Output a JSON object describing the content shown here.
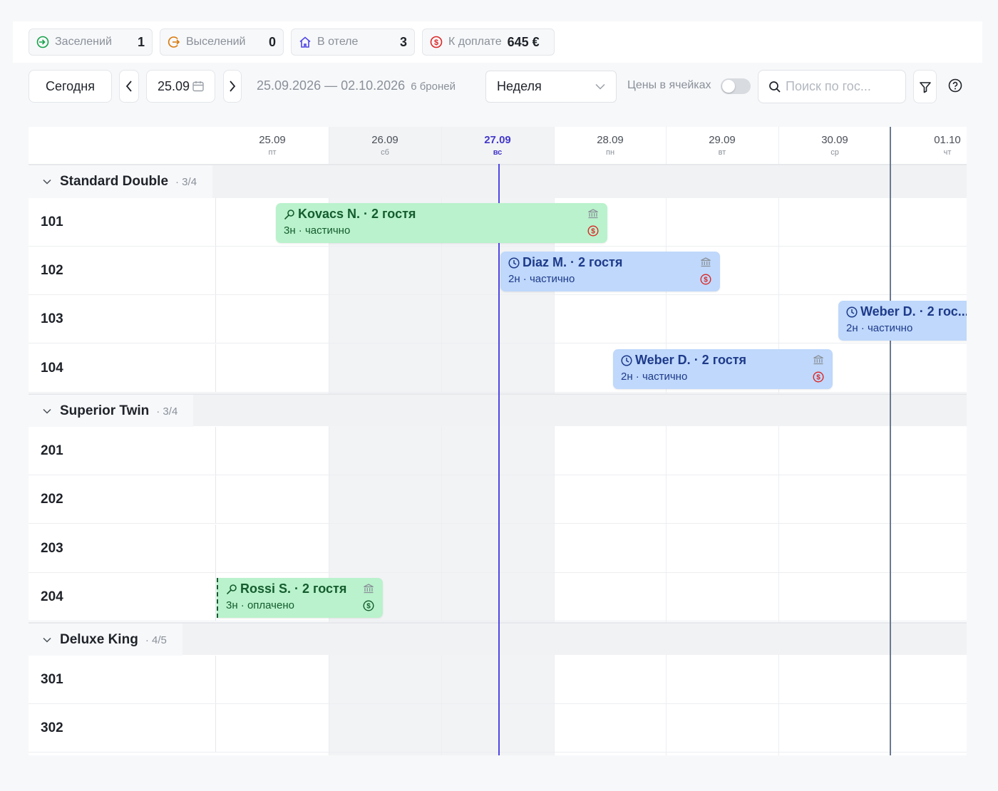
{
  "stats": {
    "checkins": {
      "label": "Заселений",
      "value": "1"
    },
    "checkouts": {
      "label": "Выселений",
      "value": "0"
    },
    "in_hotel": {
      "label": "В отеле",
      "value": "3"
    },
    "due": {
      "label": "К доплате",
      "value": "645 €"
    }
  },
  "toolbar": {
    "today_label": "Сегодня",
    "date_value": "25.09",
    "range": "25.09.2026 — 02.10.2026",
    "bookings_count": "6 броней",
    "view_select": "Неделя",
    "prices_label": "Цены в ячейках",
    "search_placeholder": "Поиск по гос..."
  },
  "days": [
    {
      "date": "25.09",
      "weekday": "пт"
    },
    {
      "date": "26.09",
      "weekday": "сб"
    },
    {
      "date": "27.09",
      "weekday": "вс"
    },
    {
      "date": "28.09",
      "weekday": "пн"
    },
    {
      "date": "29.09",
      "weekday": "вт"
    },
    {
      "date": "30.09",
      "weekday": "ср"
    },
    {
      "date": "01.10",
      "weekday": "чт"
    }
  ],
  "groups": [
    {
      "name": "Standard Double",
      "count": "· 3/4",
      "rooms": [
        "101",
        "102",
        "103",
        "104"
      ]
    },
    {
      "name": "Superior Twin",
      "count": "· 3/4",
      "rooms": [
        "201",
        "202",
        "203",
        "204"
      ]
    },
    {
      "name": "Deluxe King",
      "count": "· 4/5",
      "rooms": [
        "301",
        "302"
      ]
    }
  ],
  "bookings": [
    {
      "title": "Kovacs N. · 2 гостя",
      "sub": "3н · частично",
      "color": "green",
      "icon": "key-icon",
      "pay_status": "partial"
    },
    {
      "title": "Diaz M. · 2 гостя",
      "sub": "2н · частично",
      "color": "blue",
      "icon": "clock-icon",
      "pay_status": "partial"
    },
    {
      "title": "Weber D. · 2 гос...",
      "sub": "2н · частично",
      "color": "blue",
      "icon": "clock-icon",
      "pay_status": "partial"
    },
    {
      "title": "Weber D. · 2 гостя",
      "sub": "2н · частично",
      "color": "blue",
      "icon": "clock-icon",
      "pay_status": "partial"
    },
    {
      "title": "Rossi S. · 2 гостя",
      "sub": "3н · оплачено",
      "color": "green",
      "icon": "key-icon",
      "pay_status": "paid"
    }
  ],
  "colors": {
    "accent": "#4f46e5",
    "green_booking": "#b9f2cc",
    "blue_booking": "#bfd8fb",
    "due_red": "#dc2626"
  }
}
